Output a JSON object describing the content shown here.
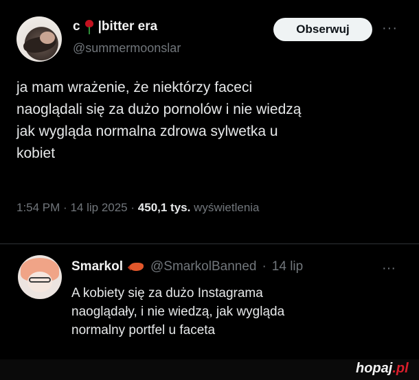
{
  "tweet": {
    "display_name": "c",
    "display_name_suffix": "|bitter era",
    "name_emoji": "rose-icon",
    "handle": "@summermoonslar",
    "follow_label": "Obserwuj",
    "more_label": "···",
    "text": "ja mam wrażenie, że niektórzy faceci\nnaoglądali się za dużo pornolów i nie wiedzą\njak wygląda normalna zdrowa  sylwetka u\nkobiet",
    "time": "1:54 PM",
    "sep1": "·",
    "date": "14 lip 2025",
    "sep2": "·",
    "views_count": "450,1 tys.",
    "views_label": "wyświetlenia"
  },
  "reply": {
    "display_name": "Smarkol",
    "name_emoji": "shrimp-icon",
    "handle": "@SmarkolBanned",
    "sep": "·",
    "date": "14 lip",
    "more_label": "···",
    "text": "A kobiety się za dużo Instagrama\nnaoglądały, i nie wiedzą, jak wygląda\nnormalny portfel u faceta"
  },
  "watermark": {
    "name": "hopaj",
    "tld": ".pl"
  }
}
